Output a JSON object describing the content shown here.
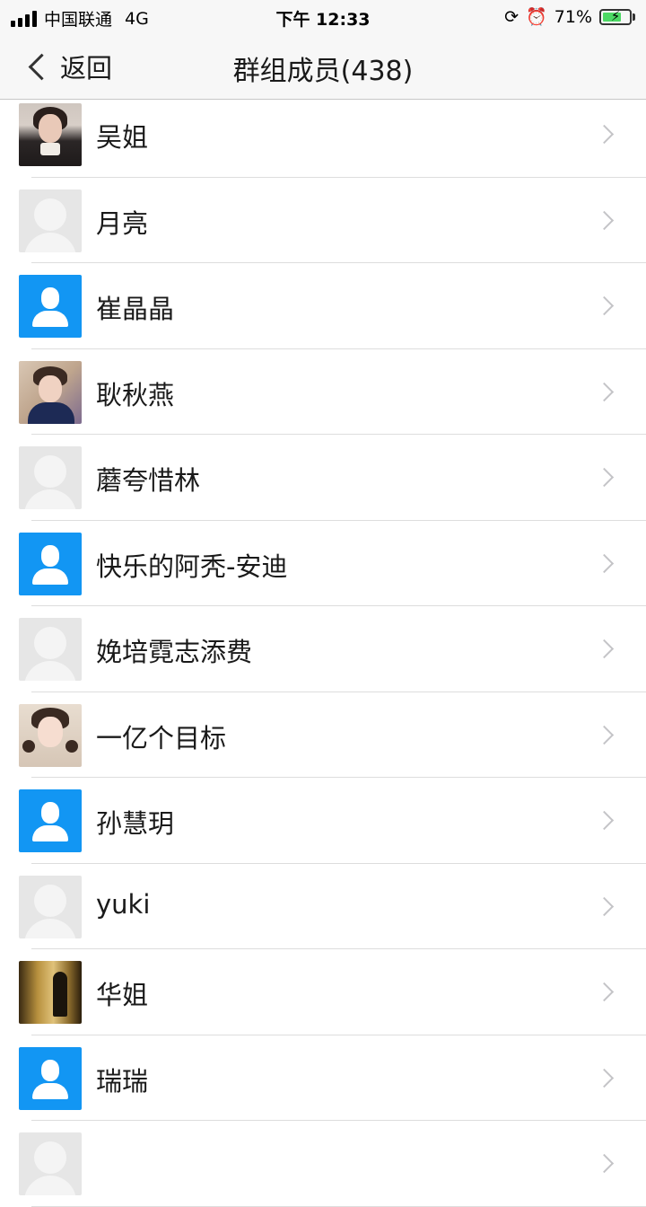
{
  "status_bar": {
    "carrier": "中国联通",
    "network": "4G",
    "time": "下午 12:33",
    "battery_percent": "71%",
    "battery_level": 0.71
  },
  "nav": {
    "back_label": "返回",
    "title": "群组成员(438)"
  },
  "members": [
    {
      "name": "吴姐",
      "avatar": "photo1"
    },
    {
      "name": "月亮",
      "avatar": "default"
    },
    {
      "name": "崔晶晶",
      "avatar": "blue"
    },
    {
      "name": "耿秋燕",
      "avatar": "photo2"
    },
    {
      "name": "蘑夸惜林",
      "avatar": "default"
    },
    {
      "name": "快乐的阿秃-安迪",
      "avatar": "blue"
    },
    {
      "name": "娩培霓志添费",
      "avatar": "default"
    },
    {
      "name": "一亿个目标",
      "avatar": "photo3"
    },
    {
      "name": "孙慧玥",
      "avatar": "blue"
    },
    {
      "name": "yuki",
      "avatar": "default"
    },
    {
      "name": "华姐",
      "avatar": "photo4"
    },
    {
      "name": "瑞瑞",
      "avatar": "blue"
    },
    {
      "name": "",
      "avatar": "default"
    }
  ],
  "colors": {
    "accent_blue": "#1296f3",
    "default_avatar_bg": "#e6e6e6",
    "divider": "#dddddd"
  }
}
